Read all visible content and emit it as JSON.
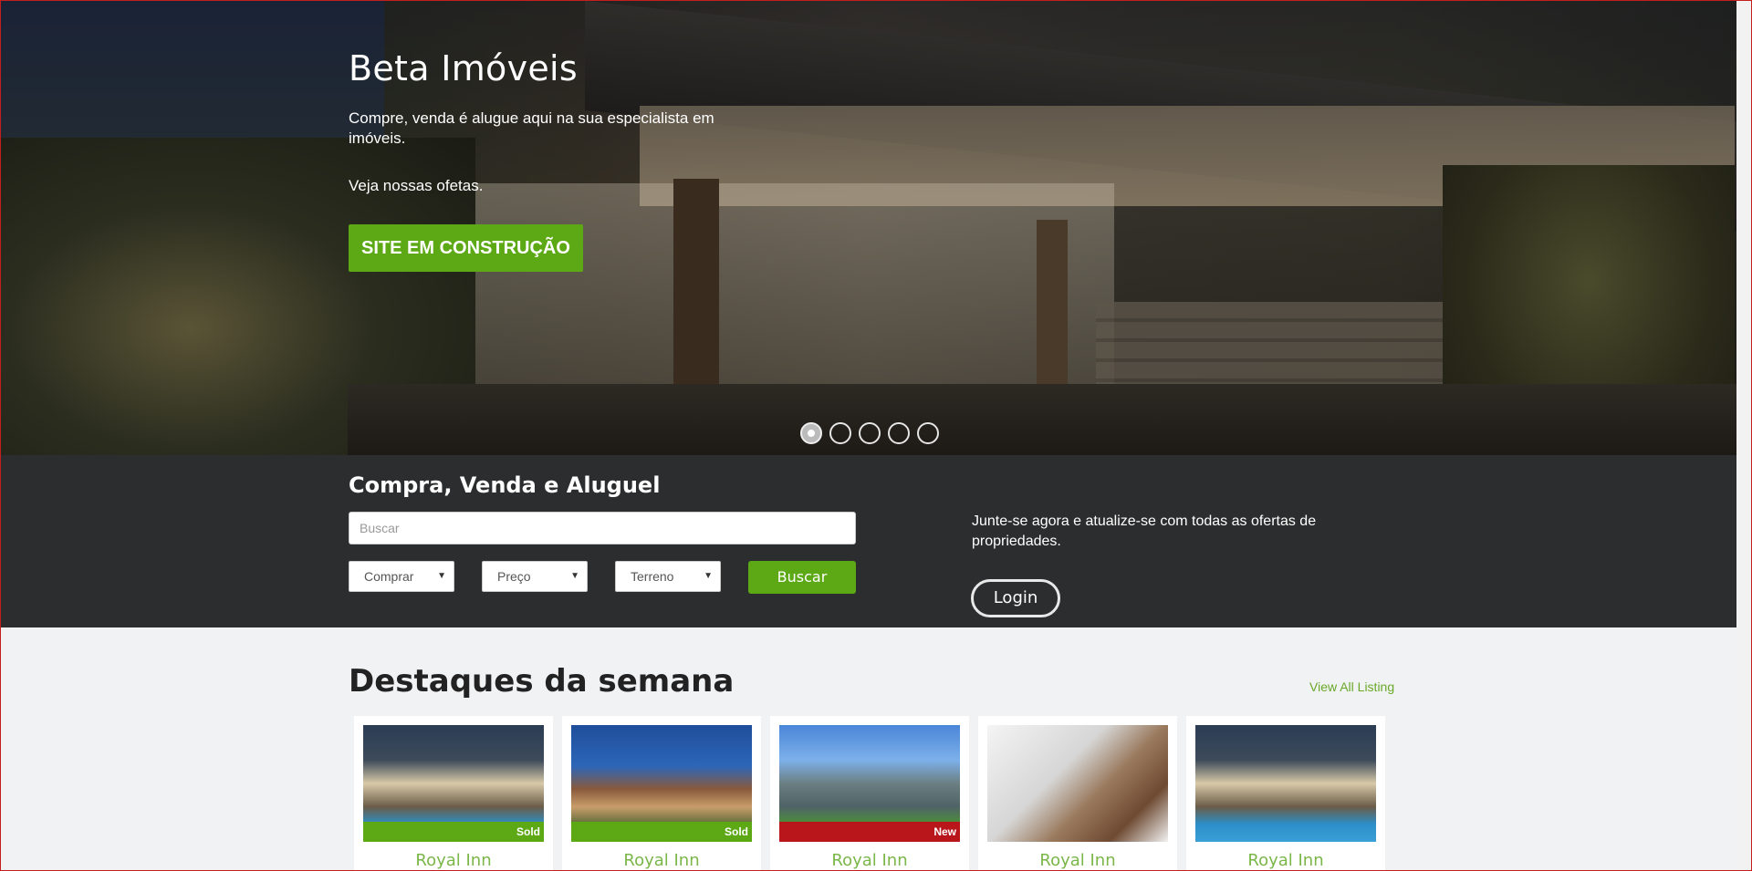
{
  "hero": {
    "title": "Beta Imóveis",
    "text": "Compre, venda é alugue aqui na sua especialista em imóveis.",
    "text2": "Veja nossas ofetas.",
    "cta_label": "SITE EM CONSTRUÇÃO",
    "slides": 5,
    "active_slide": 1
  },
  "search": {
    "title": "Compra, Venda e Aluguel",
    "placeholder": "Buscar",
    "selects": [
      "Comprar",
      "Preço",
      "Terreno"
    ],
    "button_label": "Buscar",
    "join_text": "Junte-se agora e atualize-se com todas as ofertas de propriedades.",
    "login_label": "Login"
  },
  "featured": {
    "title": "Destaques da semana",
    "view_all": "View All Listing",
    "cards": [
      {
        "name": "Royal Inn",
        "tag": "Sold",
        "tag_color": "#5ca915"
      },
      {
        "name": "Royal Inn",
        "tag": "Sold",
        "tag_color": "#5ca915"
      },
      {
        "name": "Royal Inn",
        "tag": "New",
        "tag_color": "#b8161b"
      },
      {
        "name": "Royal Inn",
        "tag": "",
        "tag_color": ""
      },
      {
        "name": "Royal Inn",
        "tag": "",
        "tag_color": ""
      }
    ]
  },
  "colors": {
    "accent": "#5ca915",
    "band": "#2c2d2e",
    "link": "#6aa82a"
  }
}
